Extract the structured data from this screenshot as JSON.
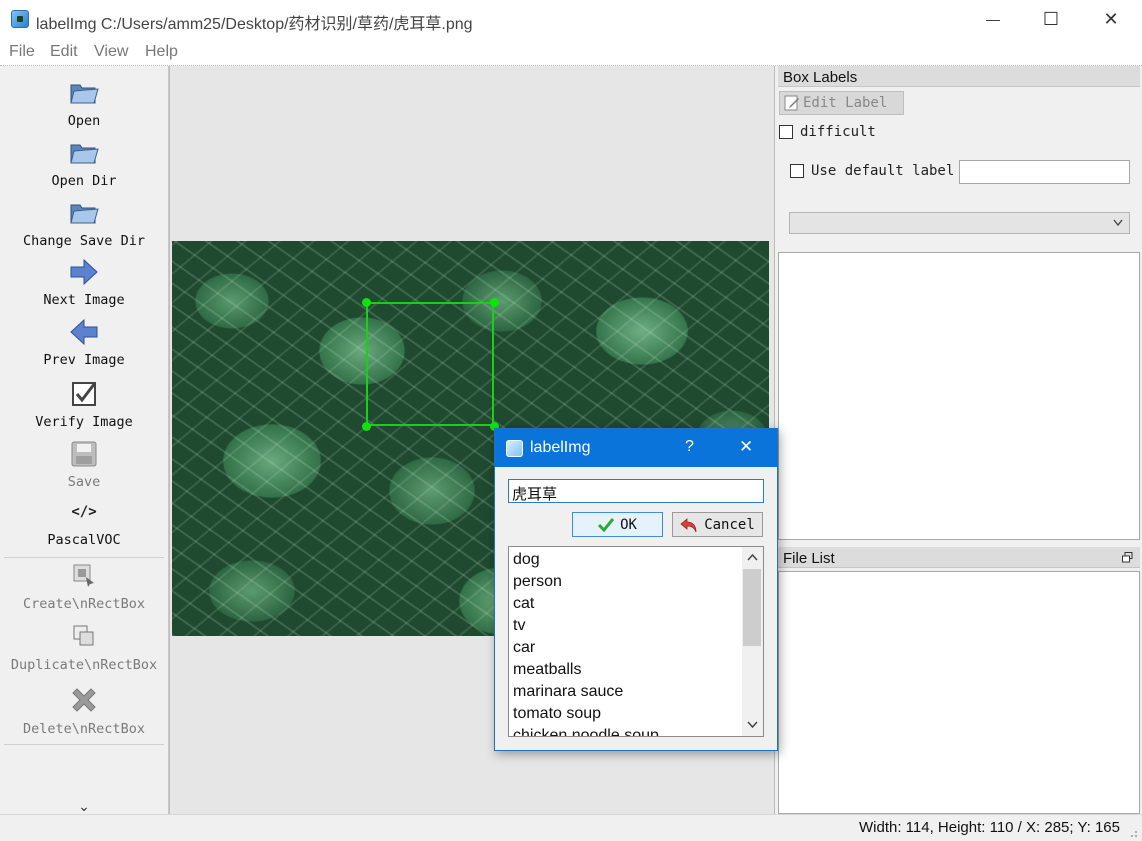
{
  "window": {
    "title": "labelImg C:/Users/amm25/Desktop/药材识别/草药/虎耳草.png",
    "minimize": "—",
    "maximize": "☐",
    "close": "✕"
  },
  "menu": {
    "file": "File",
    "edit": "Edit",
    "view": "View",
    "help": "Help"
  },
  "toolbar": {
    "open": "Open",
    "open_dir": "Open Dir",
    "change_save_dir": "Change Save Dir",
    "next_image": "Next Image",
    "prev_image": "Prev Image",
    "verify_image": "Verify Image",
    "save": "Save",
    "format_icon_text": "</>",
    "format": "PascalVOC",
    "create_rect": "Create\\nRectBox",
    "duplicate_rect": "Duplicate\\nRectBox",
    "delete_rect": "Delete\\nRectBox",
    "more": "⌄"
  },
  "box_labels": {
    "title": "Box Labels",
    "edit_label": "Edit Label",
    "difficult": "difficult",
    "use_default_label": "Use default label",
    "default_label_value": ""
  },
  "file_list": {
    "title": "File List"
  },
  "dialog": {
    "title": "labelImg",
    "help": "?",
    "close": "✕",
    "input_value": "虎耳草",
    "ok": "OK",
    "cancel": "Cancel",
    "labels": [
      "dog",
      "person",
      "cat",
      "tv",
      "car",
      "meatballs",
      "marinara sauce",
      "tomato soup",
      "chicken noodle soup"
    ]
  },
  "status": {
    "text": "Width: 114, Height: 110 / X: 285; Y: 165"
  },
  "colors": {
    "bbox": "#17d017",
    "dialog_title": "#0a74da"
  }
}
